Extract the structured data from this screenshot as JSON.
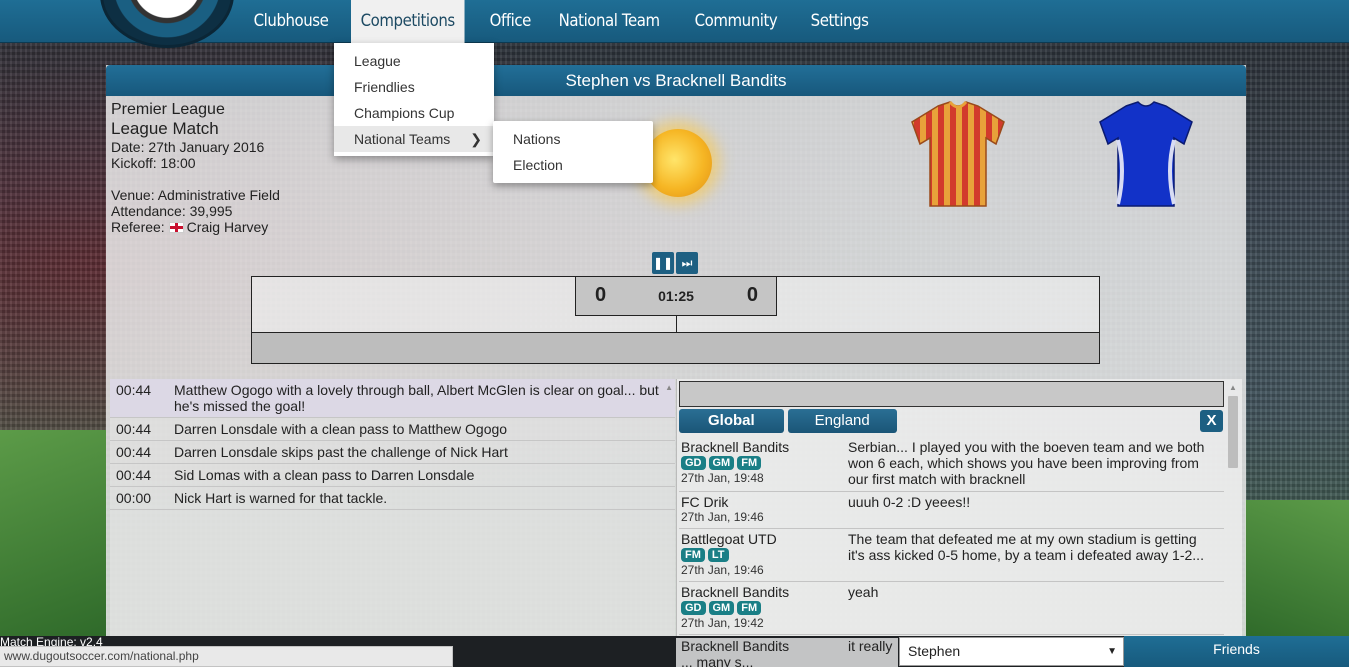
{
  "nav": {
    "items": [
      "Clubhouse",
      "Competitions",
      "Office",
      "National Team",
      "Community",
      "Settings"
    ],
    "active": "Competitions"
  },
  "dropdown": {
    "items": [
      "League",
      "Friendlies",
      "Champions Cup",
      "National Teams"
    ],
    "submenu": [
      "Nations",
      "Election"
    ]
  },
  "match": {
    "title": "Stephen vs Bracknell Bandits",
    "competition": "Premier League",
    "type": "League Match",
    "date": "Date: 27th January 2016",
    "kickoff": "Kickoff: 18:00",
    "venue": "Venue: Administrative Field",
    "attendance": "Attendance: 39,995",
    "referee_label": "Referee:",
    "referee_name": "Craig Harvey",
    "home_score": "0",
    "away_score": "0",
    "clock": "01:25",
    "home_kit_colors": [
      "#e8a23a",
      "#d23a2c"
    ],
    "away_kit_color": "#1232c8"
  },
  "commentary": [
    {
      "time": "00:44",
      "text": "Matthew Ogogo with a lovely through ball, Albert McGlen is clear on goal... but he's missed the goal!"
    },
    {
      "time": "00:44",
      "text": "Darren Lonsdale with a clean pass to Matthew Ogogo"
    },
    {
      "time": "00:44",
      "text": "Darren Lonsdale skips past the challenge of Nick Hart"
    },
    {
      "time": "00:44",
      "text": "Sid Lomas with a clean pass to Darren Lonsdale"
    },
    {
      "time": "00:00",
      "text": "Nick Hart is warned for that tackle."
    }
  ],
  "chat": {
    "tabs": [
      "Global",
      "England"
    ],
    "close": "X",
    "messages": [
      {
        "user": "Bracknell Bandits",
        "badges": [
          "GD",
          "GM",
          "FM"
        ],
        "when": "27th Jan, 19:48",
        "text": "Serbian... I played you with the boeven team and we both won 6 each, which shows you have been improving from our first match with bracknell"
      },
      {
        "user": "FC Drik",
        "badges": [],
        "when": "27th Jan, 19:46",
        "text": "uuuh 0-2 :D yeees!!"
      },
      {
        "user": "Battlegoat UTD",
        "badges": [
          "FM",
          "LT"
        ],
        "when": "27th Jan, 19:46",
        "text": "The team that defeated me at my own stadium is getting it's ass kicked 0-5 home, by a team i defeated away 1-2..."
      },
      {
        "user": "Bracknell Bandits",
        "badges": [
          "GD",
          "GM",
          "FM"
        ],
        "when": "27th Jan, 19:42",
        "text": "yeah"
      }
    ],
    "overflow_user": "Bracknell Bandits",
    "overflow_text": "it really ... many s..."
  },
  "footer": {
    "engine": "Match Engine: v2.4",
    "url": "www.dugoutsoccer.com/national.php",
    "team_select": "Stephen",
    "friends": "Friends"
  }
}
